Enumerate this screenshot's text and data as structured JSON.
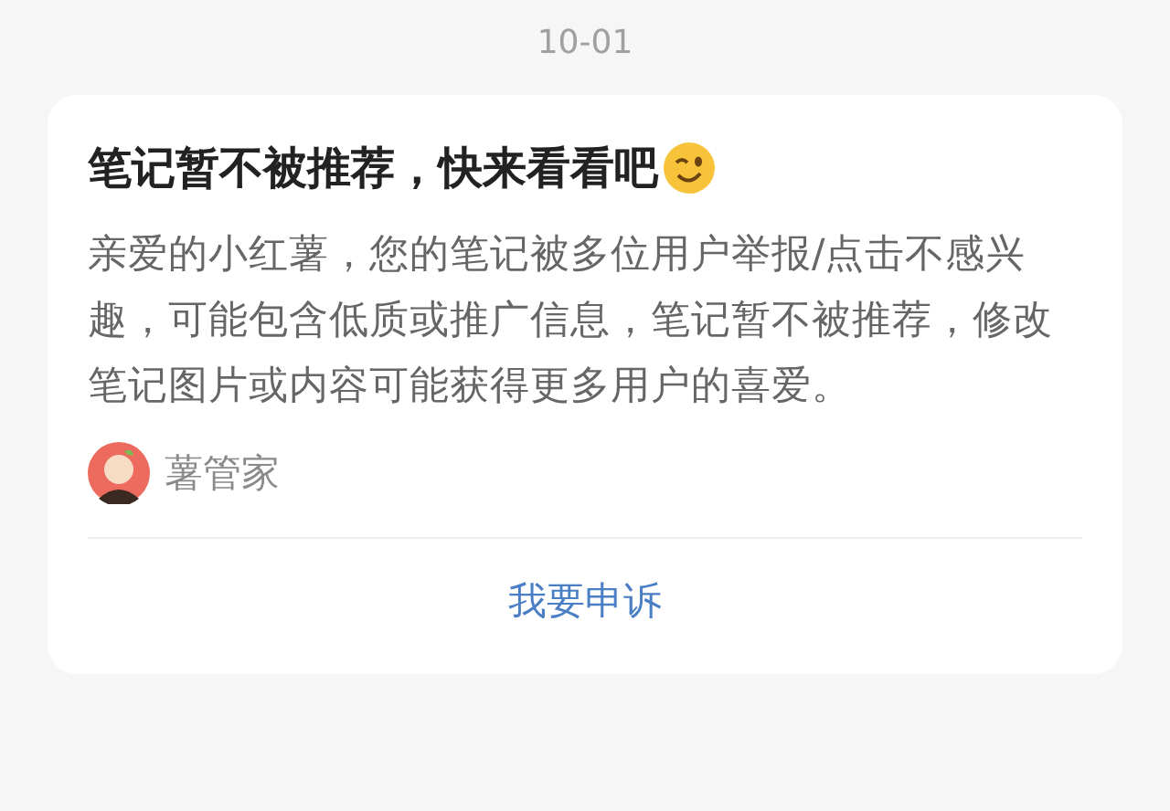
{
  "date": "10-01",
  "card": {
    "title": "笔记暂不被推荐，快来看看吧",
    "body": "亲爱的小红薯，您的笔记被多位用户举报/点击不感兴趣，可能包含低质或推广信息，笔记暂不被推荐，修改笔记图片或内容可能获得更多用户的喜爱。",
    "sender": "薯管家",
    "action": "我要申诉"
  }
}
